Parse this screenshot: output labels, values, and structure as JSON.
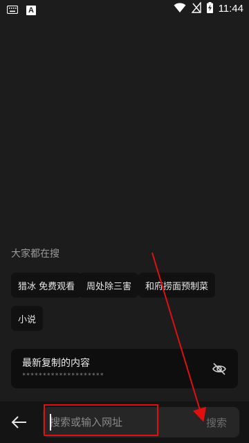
{
  "status_bar": {
    "time": "11:44",
    "left_icons": [
      "keyboard-icon",
      "font-badge-icon"
    ],
    "font_badge_text": "A",
    "right_icons": [
      "wifi-icon",
      "signal-no-sim-icon",
      "battery-charging-icon"
    ]
  },
  "trending": {
    "title": "大家都在搜",
    "chips": [
      {
        "label": "猎冰 免费观看"
      },
      {
        "label": "周处除三害"
      },
      {
        "label": "和府捞面预制菜"
      },
      {
        "label": "小说"
      }
    ]
  },
  "clipboard": {
    "title": "最新复制的内容",
    "masked_text": "********************",
    "toggle_icon": "eye-off-icon"
  },
  "bottom_bar": {
    "back_icon": "arrow-left-icon",
    "search_placeholder": "搜索或输入网址",
    "search_value": "",
    "search_button_label": "搜索"
  },
  "colors": {
    "background": "#1c1c1c",
    "chip_bg": "#111111",
    "annotation": "#e01010"
  }
}
